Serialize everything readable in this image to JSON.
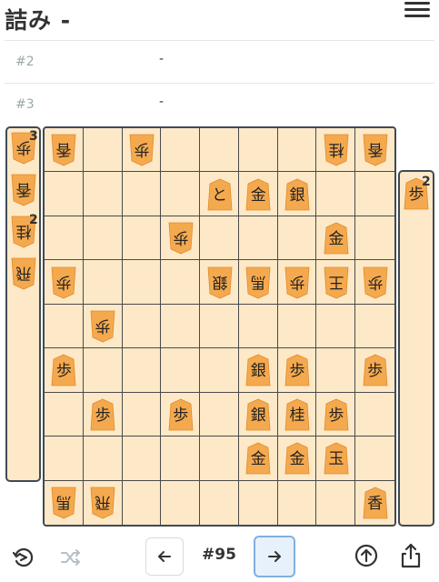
{
  "header": {
    "title": "詰み  -"
  },
  "moves": [
    {
      "label": "#2",
      "value": "-"
    },
    {
      "label": "#3",
      "value": "-"
    }
  ],
  "gote_hand": [
    {
      "char": "歩",
      "count": "3"
    },
    {
      "char": "香",
      "count": ""
    },
    {
      "char": "桂",
      "count": "2"
    },
    {
      "char": "飛",
      "count": ""
    }
  ],
  "sente_hand": [
    {
      "char": "歩",
      "count": "2"
    }
  ],
  "board": [
    {
      "col": 0,
      "row": 0,
      "char": "香",
      "side": "gote"
    },
    {
      "col": 2,
      "row": 0,
      "char": "歩",
      "side": "gote"
    },
    {
      "col": 7,
      "row": 0,
      "char": "桂",
      "side": "gote"
    },
    {
      "col": 8,
      "row": 0,
      "char": "香",
      "side": "gote"
    },
    {
      "col": 4,
      "row": 1,
      "char": "と",
      "side": "sente"
    },
    {
      "col": 5,
      "row": 1,
      "char": "金",
      "side": "sente"
    },
    {
      "col": 6,
      "row": 1,
      "char": "銀",
      "side": "sente"
    },
    {
      "col": 3,
      "row": 2,
      "char": "歩",
      "side": "gote"
    },
    {
      "col": 7,
      "row": 2,
      "char": "金",
      "side": "sente"
    },
    {
      "col": 0,
      "row": 3,
      "char": "歩",
      "side": "gote"
    },
    {
      "col": 4,
      "row": 3,
      "char": "銀",
      "side": "gote"
    },
    {
      "col": 5,
      "row": 3,
      "char": "馬",
      "side": "gote"
    },
    {
      "col": 6,
      "row": 3,
      "char": "歩",
      "side": "gote"
    },
    {
      "col": 7,
      "row": 3,
      "char": "王",
      "side": "gote"
    },
    {
      "col": 8,
      "row": 3,
      "char": "歩",
      "side": "gote"
    },
    {
      "col": 1,
      "row": 4,
      "char": "歩",
      "side": "gote"
    },
    {
      "col": 0,
      "row": 5,
      "char": "歩",
      "side": "sente"
    },
    {
      "col": 5,
      "row": 5,
      "char": "銀",
      "side": "sente"
    },
    {
      "col": 6,
      "row": 5,
      "char": "歩",
      "side": "sente"
    },
    {
      "col": 8,
      "row": 5,
      "char": "歩",
      "side": "sente"
    },
    {
      "col": 1,
      "row": 6,
      "char": "歩",
      "side": "sente"
    },
    {
      "col": 3,
      "row": 6,
      "char": "歩",
      "side": "sente"
    },
    {
      "col": 5,
      "row": 6,
      "char": "銀",
      "side": "sente"
    },
    {
      "col": 6,
      "row": 6,
      "char": "桂",
      "side": "sente"
    },
    {
      "col": 7,
      "row": 6,
      "char": "歩",
      "side": "sente"
    },
    {
      "col": 5,
      "row": 7,
      "char": "金",
      "side": "sente"
    },
    {
      "col": 6,
      "row": 7,
      "char": "金",
      "side": "sente"
    },
    {
      "col": 7,
      "row": 7,
      "char": "玉",
      "side": "sente"
    },
    {
      "col": 0,
      "row": 8,
      "char": "馬",
      "side": "gote"
    },
    {
      "col": 1,
      "row": 8,
      "char": "飛",
      "side": "gote"
    },
    {
      "col": 8,
      "row": 8,
      "char": "香",
      "side": "sente"
    }
  ],
  "footer": {
    "move_number": "#95",
    "icons": [
      "flip-board-icon",
      "shuffle-icon",
      "arrow-left-icon",
      "arrow-right-icon",
      "arrow-up-circle-icon",
      "share-icon"
    ]
  },
  "colors": {
    "piece": "#f5a94e",
    "board": "#fde9c8",
    "border": "#3f4a56",
    "active_button": "#7fb0e0"
  }
}
